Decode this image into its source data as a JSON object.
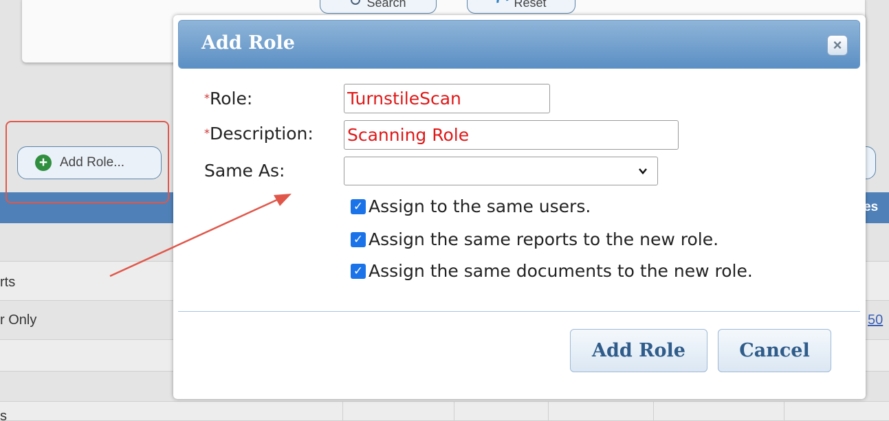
{
  "background": {
    "search_button_label": "Search",
    "reset_button_label": "Reset",
    "add_role_button_label": "Add Role...",
    "grid_header_partial": "es",
    "rows": [
      {
        "text": ""
      },
      {
        "text": "rts"
      },
      {
        "text": "r Only"
      },
      {
        "text": ""
      },
      {
        "text": ""
      },
      {
        "text": "s"
      }
    ],
    "row_link_partial": "50"
  },
  "dialog": {
    "title": "Add Role",
    "close_icon": "×",
    "fields": {
      "role": {
        "required_mark": "*",
        "label": "Role:",
        "value": "TurnstileScan"
      },
      "description": {
        "required_mark": "*",
        "label": "Description:",
        "value": "Scanning Role"
      },
      "same_as": {
        "label": "Same As:",
        "value": ""
      }
    },
    "options": [
      {
        "label": "Assign to the same users.",
        "checked": true
      },
      {
        "label": "Assign the same reports to the new role.",
        "checked": true
      },
      {
        "label": "Assign the same documents to the new role.",
        "checked": true
      }
    ],
    "buttons": {
      "add_role": "Add Role",
      "cancel": "Cancel"
    }
  },
  "colors": {
    "header_blue": "#4f81b8",
    "annotation_red": "#e0574a",
    "checkbox_blue": "#1a73e8",
    "input_text_red": "#e01818"
  }
}
